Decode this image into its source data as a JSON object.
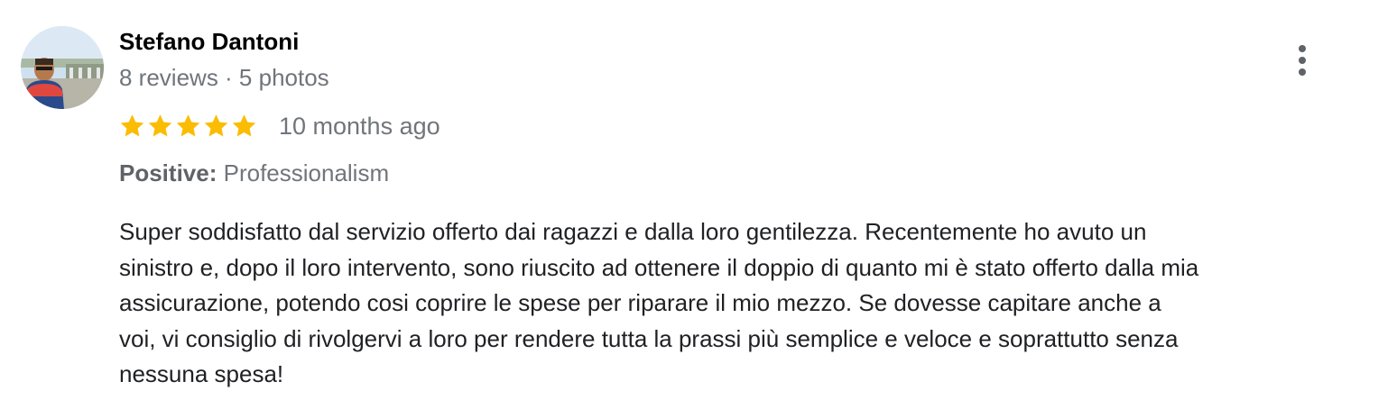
{
  "review": {
    "author": {
      "name": "Stefano Dantoni",
      "stats": "8 reviews · 5 photos",
      "avatar": "profile-photo"
    },
    "rating": {
      "stars": 5,
      "max": 5,
      "star_color": "#fbbc04"
    },
    "date": "10 months ago",
    "highlights": {
      "label": "Positive:",
      "value": "Professionalism"
    },
    "text": "Super soddisfatto dal servizio offerto dai ragazzi e dalla loro gentilezza. Recentemente ho avuto un\nsinistro e, dopo il loro intervento, sono riuscito ad ottenere il doppio di quanto mi è stato offerto dalla mia\nassicurazione, potendo cosi coprire le spese per riparare il mio mezzo. Se dovesse capitare anche a\nvoi, vi consiglio di rivolgervi a loro per rendere tutta la prassi più semplice e veloce e soprattutto senza\nnessuna spesa!",
    "menu_icon": "more-vert-icon"
  },
  "colors": {
    "name": "#000000",
    "secondary_text": "#70757a",
    "body_text": "#202124",
    "menu_icon": "#5f6368"
  }
}
